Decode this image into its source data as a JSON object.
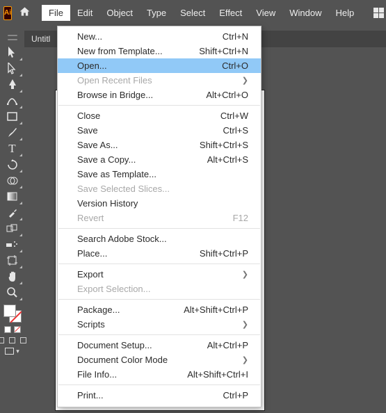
{
  "appBadge": "Ai",
  "menubar": [
    "File",
    "Edit",
    "Object",
    "Type",
    "Select",
    "Effect",
    "View",
    "Window",
    "Help"
  ],
  "activeMenuIndex": 0,
  "tab": {
    "title": "Untitl"
  },
  "fileMenu": [
    {
      "type": "item",
      "label": "New...",
      "shortcut": "Ctrl+N"
    },
    {
      "type": "item",
      "label": "New from Template...",
      "shortcut": "Shift+Ctrl+N"
    },
    {
      "type": "item",
      "label": "Open...",
      "shortcut": "Ctrl+O",
      "selected": true
    },
    {
      "type": "item",
      "label": "Open Recent Files",
      "submenu": true,
      "disabled": true
    },
    {
      "type": "item",
      "label": "Browse in Bridge...",
      "shortcut": "Alt+Ctrl+O"
    },
    {
      "type": "sep"
    },
    {
      "type": "item",
      "label": "Close",
      "shortcut": "Ctrl+W"
    },
    {
      "type": "item",
      "label": "Save",
      "shortcut": "Ctrl+S"
    },
    {
      "type": "item",
      "label": "Save As...",
      "shortcut": "Shift+Ctrl+S"
    },
    {
      "type": "item",
      "label": "Save a Copy...",
      "shortcut": "Alt+Ctrl+S"
    },
    {
      "type": "item",
      "label": "Save as Template..."
    },
    {
      "type": "item",
      "label": "Save Selected Slices...",
      "disabled": true
    },
    {
      "type": "item",
      "label": "Version History"
    },
    {
      "type": "item",
      "label": "Revert",
      "shortcut": "F12",
      "disabled": true
    },
    {
      "type": "sep"
    },
    {
      "type": "item",
      "label": "Search Adobe Stock..."
    },
    {
      "type": "item",
      "label": "Place...",
      "shortcut": "Shift+Ctrl+P"
    },
    {
      "type": "sep"
    },
    {
      "type": "item",
      "label": "Export",
      "submenu": true
    },
    {
      "type": "item",
      "label": "Export Selection...",
      "disabled": true
    },
    {
      "type": "sep"
    },
    {
      "type": "item",
      "label": "Package...",
      "shortcut": "Alt+Shift+Ctrl+P"
    },
    {
      "type": "item",
      "label": "Scripts",
      "submenu": true
    },
    {
      "type": "sep"
    },
    {
      "type": "item",
      "label": "Document Setup...",
      "shortcut": "Alt+Ctrl+P"
    },
    {
      "type": "item",
      "label": "Document Color Mode",
      "submenu": true
    },
    {
      "type": "item",
      "label": "File Info...",
      "shortcut": "Alt+Shift+Ctrl+I"
    },
    {
      "type": "sep"
    },
    {
      "type": "item",
      "label": "Print...",
      "shortcut": "Ctrl+P"
    }
  ],
  "tools": [
    "selection",
    "direct-selection",
    "pen",
    "curvature",
    "rectangle",
    "paintbrush",
    "type",
    "rotate",
    "shape-builder",
    "gradient",
    "eyedropper",
    "blend",
    "symbol-sprayer",
    "artboard",
    "hand",
    "zoom"
  ]
}
